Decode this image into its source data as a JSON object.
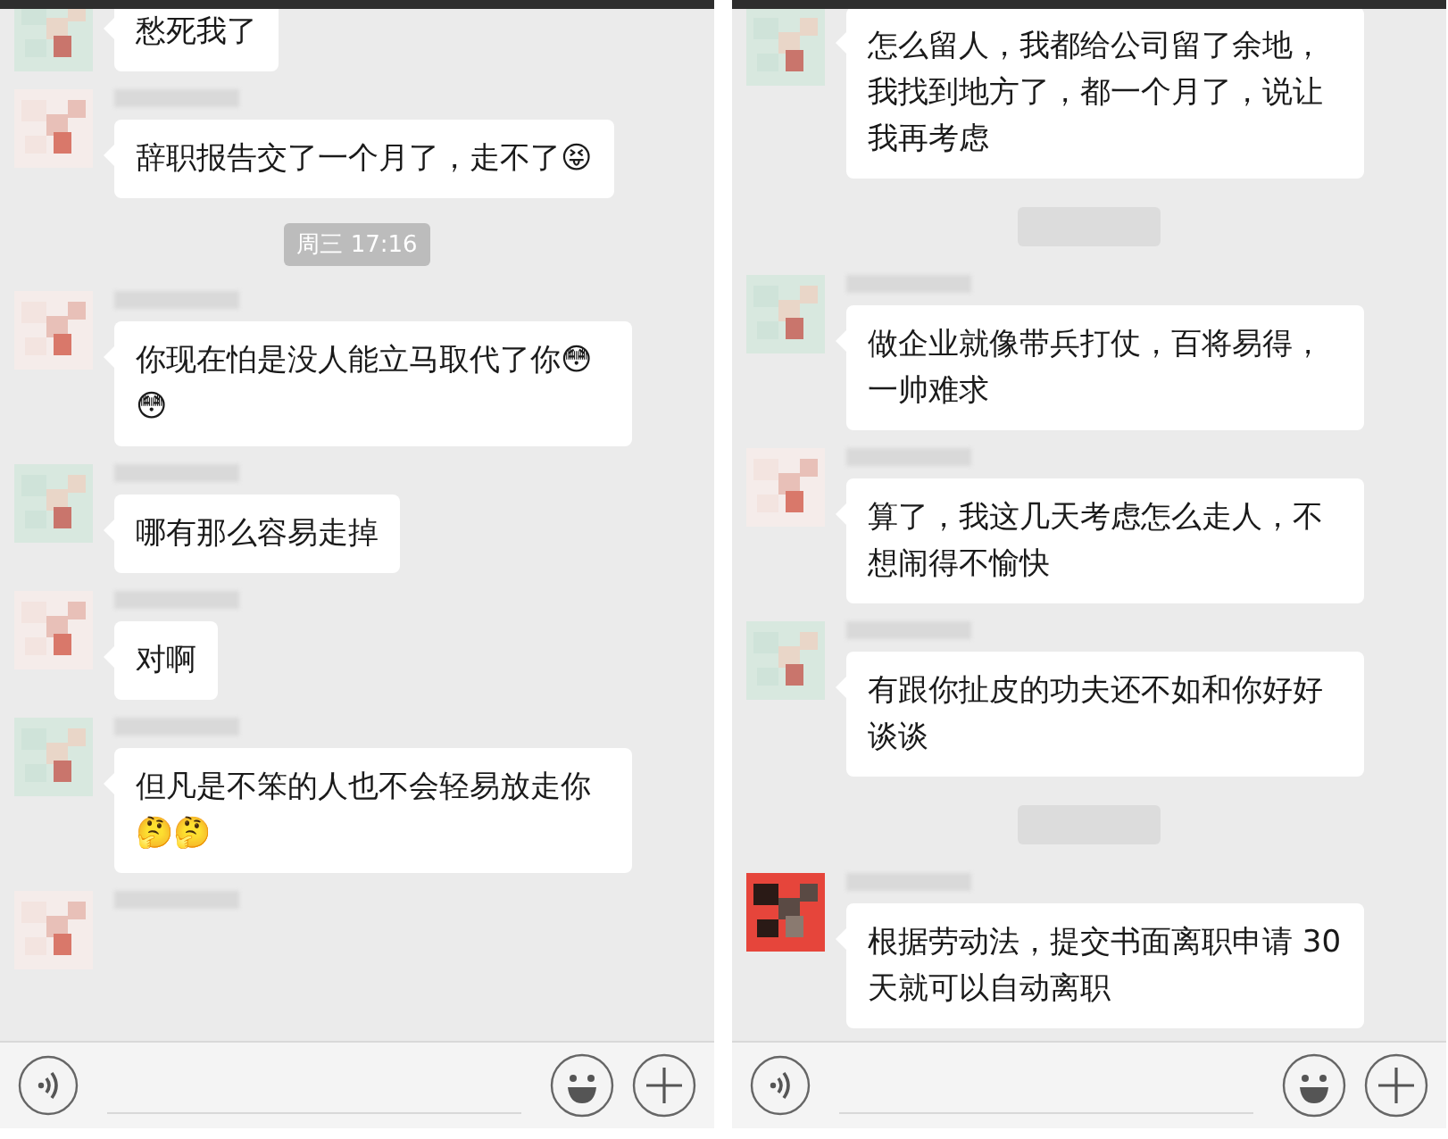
{
  "panels": [
    {
      "items": [
        {
          "kind": "message",
          "text": "愁死我了"
        },
        {
          "kind": "message",
          "text": "辞职报告交了一个月了，走不了😝"
        },
        {
          "kind": "time",
          "text": "周三 17:16"
        },
        {
          "kind": "message",
          "text": "你现在怕是没人能立马取代了你😳😳"
        },
        {
          "kind": "message",
          "text": "哪有那么容易走掉"
        },
        {
          "kind": "message",
          "text": "对啊"
        },
        {
          "kind": "message",
          "text": "但凡是不笨的人也不会轻易放走你🤔🤔"
        },
        {
          "kind": "partial"
        }
      ]
    },
    {
      "items": [
        {
          "kind": "message",
          "text": "怎么留人，我都给公司留了余地，我找到地方了，都一个月了，说让我再考虑"
        },
        {
          "kind": "time_blurred"
        },
        {
          "kind": "message",
          "text": "做企业就像带兵打仗，百将易得，一帅难求"
        },
        {
          "kind": "message",
          "text": "算了，我这几天考虑怎么走人，不想闹得不愉快"
        },
        {
          "kind": "message",
          "text": "有跟你扯皮的功夫还不如和你好好谈谈"
        },
        {
          "kind": "time_blurred"
        },
        {
          "kind": "message",
          "text": "根据劳动法，提交书面离职申请 30 天就可以自动离职"
        }
      ]
    }
  ]
}
